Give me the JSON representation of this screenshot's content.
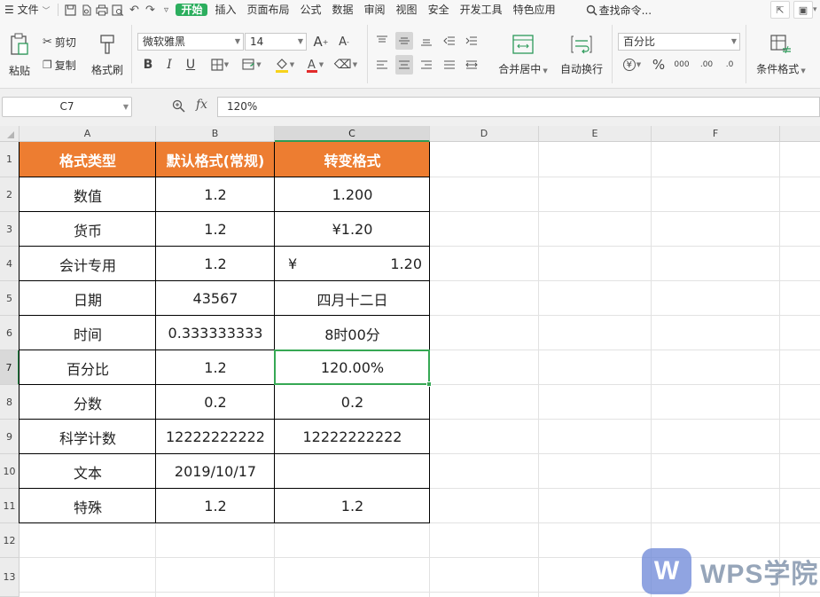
{
  "menubar": {
    "file_label": "文件",
    "tabs": [
      "开始",
      "插入",
      "页面布局",
      "公式",
      "数据",
      "审阅",
      "视图",
      "安全",
      "开发工具",
      "特色应用"
    ],
    "active_tab": "开始",
    "search_label": "查找命令..."
  },
  "ribbon": {
    "paste": "粘贴",
    "cut": "剪切",
    "copy": "复制",
    "format_painter": "格式刷",
    "font_name": "微软雅黑",
    "font_size": "14",
    "bold": "B",
    "italic": "I",
    "underline": "U",
    "merge_center": "合并居中",
    "wrap_text": "自动换行",
    "number_format": "百分比",
    "conditional_format": "条件格式",
    "currency_symbol": "¥",
    "percent_symbol": "%",
    "thousands_symbol": "000",
    "inc_decimal": ".00",
    "dec_decimal": ".0"
  },
  "formula_bar": {
    "name_box": "C7",
    "fx": "fx",
    "value": "120%"
  },
  "grid": {
    "columns": [
      "A",
      "B",
      "C",
      "D",
      "E",
      "F"
    ],
    "rows": [
      "1",
      "2",
      "3",
      "4",
      "5",
      "6",
      "7",
      "8",
      "9",
      "10",
      "11",
      "12",
      "13"
    ],
    "selected_cell": "C7",
    "header": [
      "格式类型",
      "默认格式(常规)",
      "转变格式"
    ],
    "data": [
      [
        "数值",
        "1.2",
        "1.200"
      ],
      [
        "货币",
        "1.2",
        "¥1.20"
      ],
      [
        "会计专用",
        "1.2",
        "1.20"
      ],
      [
        "日期",
        "43567",
        "四月十二日"
      ],
      [
        "时间",
        "0.333333333",
        "8时00分"
      ],
      [
        "百分比",
        "1.2",
        "120.00%"
      ],
      [
        "分数",
        "0.2",
        "0.2"
      ],
      [
        "科学计数",
        "12222222222",
        "12222222222"
      ],
      [
        "文本",
        "2019/10/17",
        ""
      ],
      [
        "特殊",
        "1.2",
        "1.2"
      ]
    ],
    "accounting_symbol": "¥"
  },
  "watermark": {
    "logo_letter": "W",
    "text": "WPS学院"
  },
  "colors": {
    "header_fill": "#ed7d31",
    "active_tab": "#2cae5e",
    "selection": "#36a854"
  }
}
